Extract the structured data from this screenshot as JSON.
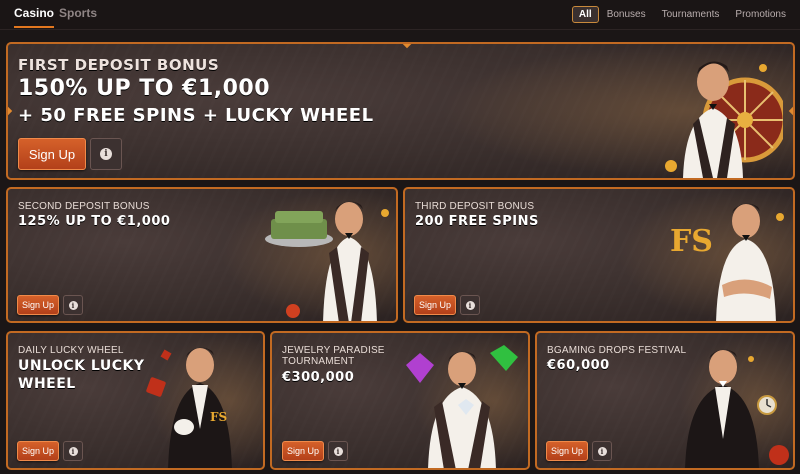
{
  "nav": {
    "tabs": [
      {
        "label": "Casino",
        "active": true
      },
      {
        "label": "Sports",
        "active": false
      }
    ],
    "filters": [
      {
        "label": "All",
        "active": true
      },
      {
        "label": "Bonuses",
        "active": false
      },
      {
        "label": "Tournaments",
        "active": false
      },
      {
        "label": "Promotions",
        "active": false
      }
    ]
  },
  "cards": {
    "first": {
      "title": "FIRST DEPOSIT BONUS",
      "line1": "150% UP TO €1,000",
      "line2": "+ 50 FREE SPINS + LUCKY WHEEL",
      "signup_label": "Sign Up",
      "info_label": "i"
    },
    "second": {
      "title": "SECOND DEPOSIT BONUS",
      "line1": "125% UP TO €1,000",
      "signup_label": "Sign Up",
      "info_label": "i"
    },
    "third": {
      "title": "THIRD DEPOSIT BONUS",
      "line1": "200 FREE SPINS",
      "signup_label": "Sign Up",
      "info_label": "i"
    },
    "wheel": {
      "title": "DAILY LUCKY WHEEL",
      "line1": "UNLOCK LUCKY",
      "line2": "WHEEL",
      "badge": "FS",
      "signup_label": "Sign Up",
      "info_label": "i"
    },
    "jewelry": {
      "title_line1": "JEWELRY PARADISE",
      "title_line2": "TOURNAMENT",
      "line1": "€300,000",
      "signup_label": "Sign Up",
      "info_label": "i"
    },
    "drops": {
      "title": "BGAMING DROPS FESTIVAL",
      "line1": "€60,000",
      "signup_label": "Sign Up",
      "info_label": "i"
    }
  },
  "colors": {
    "accent": "#e2771f",
    "card_border": "#c26a22",
    "signup_button": "#c4502a",
    "background": "#1b1616"
  },
  "icons": [
    "info-icon",
    "fs-badge-icon",
    "gem-icon",
    "coin-icon",
    "wheel-icon",
    "dice-icon"
  ]
}
